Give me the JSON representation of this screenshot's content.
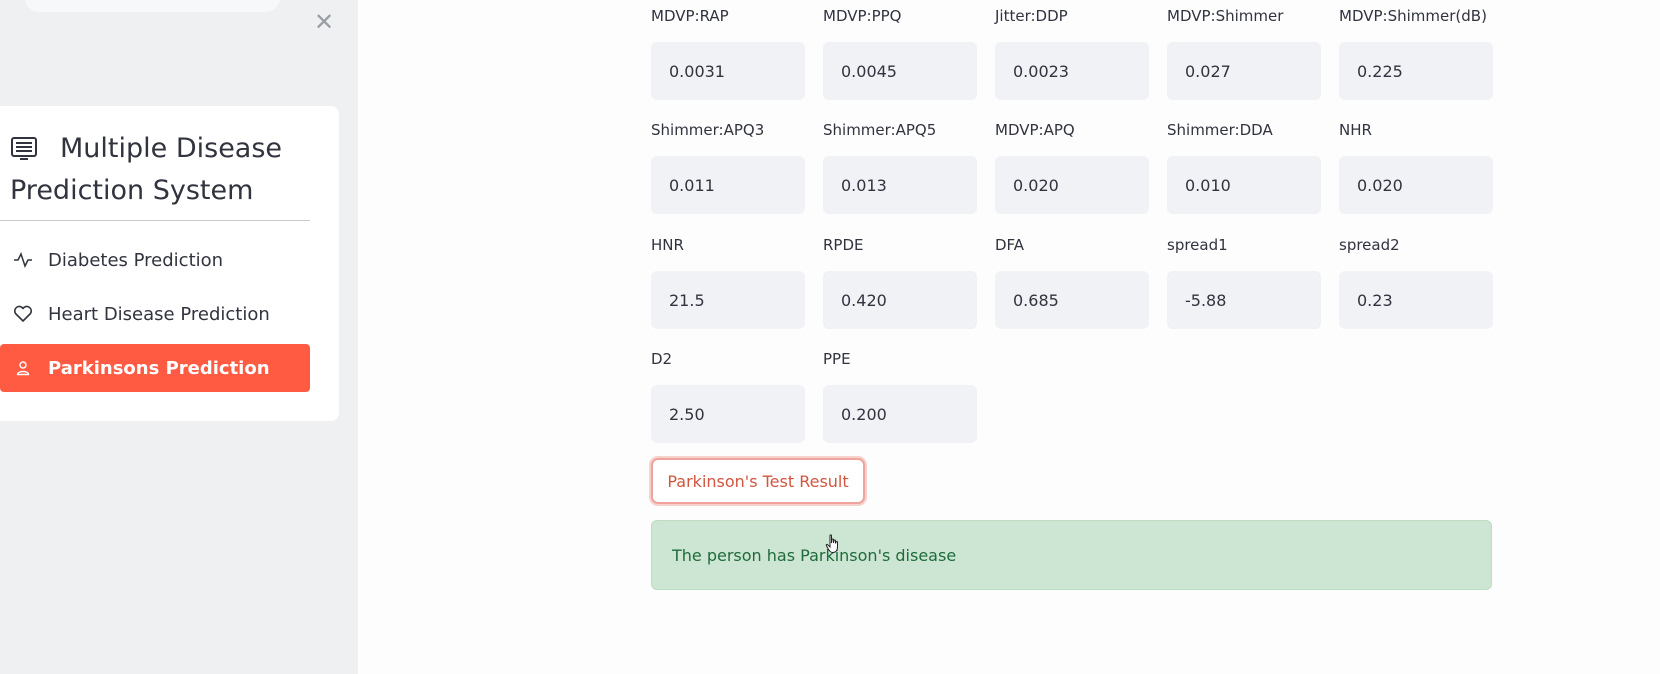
{
  "sidebar": {
    "title_line1": "Multiple Disease",
    "title_line2": "Prediction System",
    "items": [
      {
        "label": "Diabetes Prediction",
        "icon": "activity-icon"
      },
      {
        "label": "Heart Disease Prediction",
        "icon": "heart-icon"
      },
      {
        "label": "Parkinsons Prediction",
        "icon": "person-icon",
        "active": true
      }
    ],
    "close_symbol": "✕"
  },
  "form": {
    "fields": [
      {
        "label": "MDVP:RAP",
        "value": "0.0031"
      },
      {
        "label": "MDVP:PPQ",
        "value": "0.0045"
      },
      {
        "label": "Jitter:DDP",
        "value": "0.0023"
      },
      {
        "label": "MDVP:Shimmer",
        "value": "0.027"
      },
      {
        "label": "MDVP:Shimmer(dB)",
        "value": "0.225"
      },
      {
        "label": "Shimmer:APQ3",
        "value": "0.011"
      },
      {
        "label": "Shimmer:APQ5",
        "value": "0.013"
      },
      {
        "label": "MDVP:APQ",
        "value": "0.020"
      },
      {
        "label": "Shimmer:DDA",
        "value": "0.010"
      },
      {
        "label": "NHR",
        "value": "0.020"
      },
      {
        "label": "HNR",
        "value": "21.5"
      },
      {
        "label": "RPDE",
        "value": "0.420"
      },
      {
        "label": "DFA",
        "value": "0.685"
      },
      {
        "label": "spread1",
        "value": "-5.88"
      },
      {
        "label": "spread2",
        "value": "0.23"
      },
      {
        "label": "D2",
        "value": "2.50"
      },
      {
        "label": "PPE",
        "value": "0.200"
      }
    ],
    "submit_label": "Parkinson's Test Result",
    "result_text": "The person has Parkinson's disease"
  },
  "colors": {
    "accent": "#ff5a42",
    "success_bg": "#cde6d3",
    "success_text": "#1f6b3a"
  }
}
